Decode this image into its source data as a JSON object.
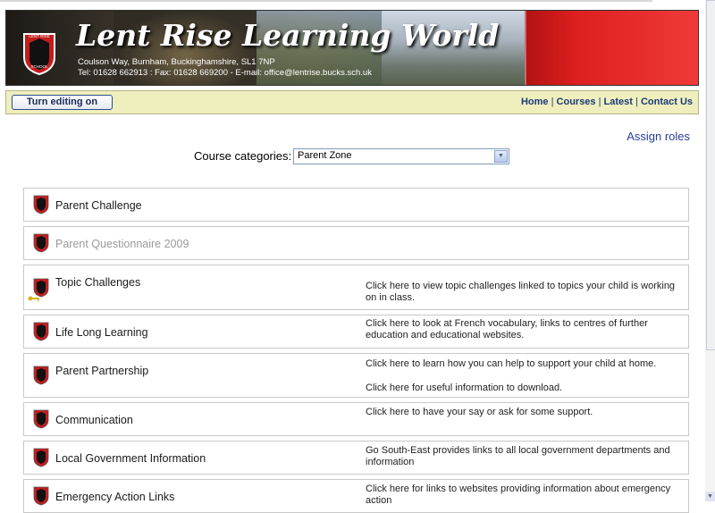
{
  "banner": {
    "title": "Lent Rise Learning World",
    "address": "Coulson Way, Burnham, Buckinghamshire, SL1 7NP",
    "contact": "Tel: 01628 662913 : Fax: 01628 669200 - E-mail: office@lentrise.bucks.sch.uk",
    "crest_text_top": "LENT RISE",
    "crest_text_bottom": "SCHOOL"
  },
  "navbar": {
    "edit_button": "Turn editing on",
    "links": [
      "Home",
      "Courses",
      "Latest",
      "Contact Us"
    ],
    "separator": "|"
  },
  "assign_roles": "Assign roles",
  "categories": {
    "label": "Course categories:",
    "selected": "Parent Zone"
  },
  "courses": [
    {
      "name": "Parent Challenge",
      "desc1": "",
      "desc2": "",
      "dimmed": false,
      "guest_key": false
    },
    {
      "name": "Parent Questionnaire 2009",
      "desc1": "",
      "desc2": "",
      "dimmed": true,
      "guest_key": false
    },
    {
      "name": "Topic Challenges",
      "desc1": "Click here to view topic challenges linked to topics your child is working on in class.",
      "desc2": "",
      "dimmed": false,
      "guest_key": true
    },
    {
      "name": "Life Long Learning",
      "desc1": "Click here to look at French vocabulary, links to centres of further education and educational  websites.",
      "desc2": "",
      "dimmed": false,
      "guest_key": false
    },
    {
      "name": "Parent Partnership",
      "desc1": "Click here to learn how you can help to support your child at home.",
      "desc2": "Click here for useful information to download.",
      "dimmed": false,
      "guest_key": false
    },
    {
      "name": "Communication",
      "desc1": "Click here to have your say or ask for some support.",
      "desc2": "",
      "dimmed": false,
      "guest_key": false
    },
    {
      "name": "Local Government Information",
      "desc1": "Go South-East provides links to all local government departments and information",
      "desc2": "",
      "dimmed": false,
      "guest_key": false
    },
    {
      "name": "Emergency Action Links",
      "desc1": "Click here for links to websites providing information about emergency action",
      "desc2": "",
      "dimmed": false,
      "guest_key": false
    }
  ],
  "colors": {
    "navbar_bg": "#efefbd",
    "link_blue": "#2a3d9a",
    "banner_red": "#e52a2a"
  }
}
